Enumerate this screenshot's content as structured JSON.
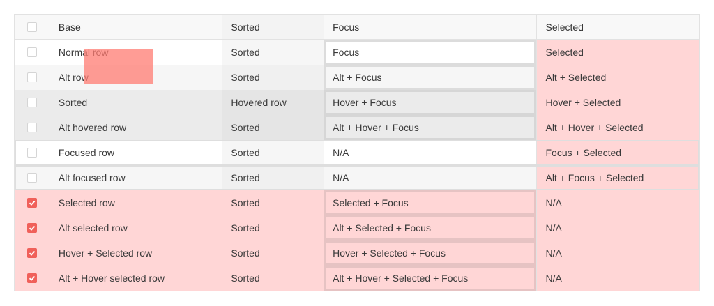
{
  "columns": [
    "Base",
    "Sorted",
    "Focus",
    "Selected"
  ],
  "rows": [
    {
      "checked": false,
      "cells": [
        "Normal row",
        "Sorted",
        "Focus",
        "Selected"
      ]
    },
    {
      "checked": false,
      "cells": [
        "Alt row",
        "Sorted",
        "Alt + Focus",
        "Alt + Selected"
      ]
    },
    {
      "checked": false,
      "cells": [
        "Sorted",
        "Hovered row",
        "Hover + Focus",
        "Hover + Selected"
      ]
    },
    {
      "checked": false,
      "cells": [
        "Alt hovered row",
        "Sorted",
        "Alt + Hover + Focus",
        "Alt + Hover + Selected"
      ]
    },
    {
      "checked": false,
      "cells": [
        "Focused row",
        "Sorted",
        "N/A",
        "Focus + Selected"
      ]
    },
    {
      "checked": false,
      "cells": [
        "Alt focused row",
        "Sorted",
        "N/A",
        "Alt + Focus + Selected"
      ]
    },
    {
      "checked": true,
      "cells": [
        "Selected row",
        "Sorted",
        "Selected + Focus",
        "N/A"
      ]
    },
    {
      "checked": true,
      "cells": [
        "Alt selected row",
        "Sorted",
        "Alt + Selected + Focus",
        "N/A"
      ]
    },
    {
      "checked": true,
      "cells": [
        "Hover + Selected row",
        "Sorted",
        "Hover + Selected + Focus",
        "N/A"
      ]
    },
    {
      "checked": true,
      "cells": [
        "Alt + Hover selected row",
        "Sorted",
        "Alt + Hover + Selected + Focus",
        "N/A"
      ]
    }
  ],
  "colors": {
    "accent": "#f0605a",
    "selected_bg": "#ffd6d6",
    "drag_ghost": "#ff7b72"
  },
  "icons": {
    "checkbox_checked": "checkmark-icon"
  }
}
